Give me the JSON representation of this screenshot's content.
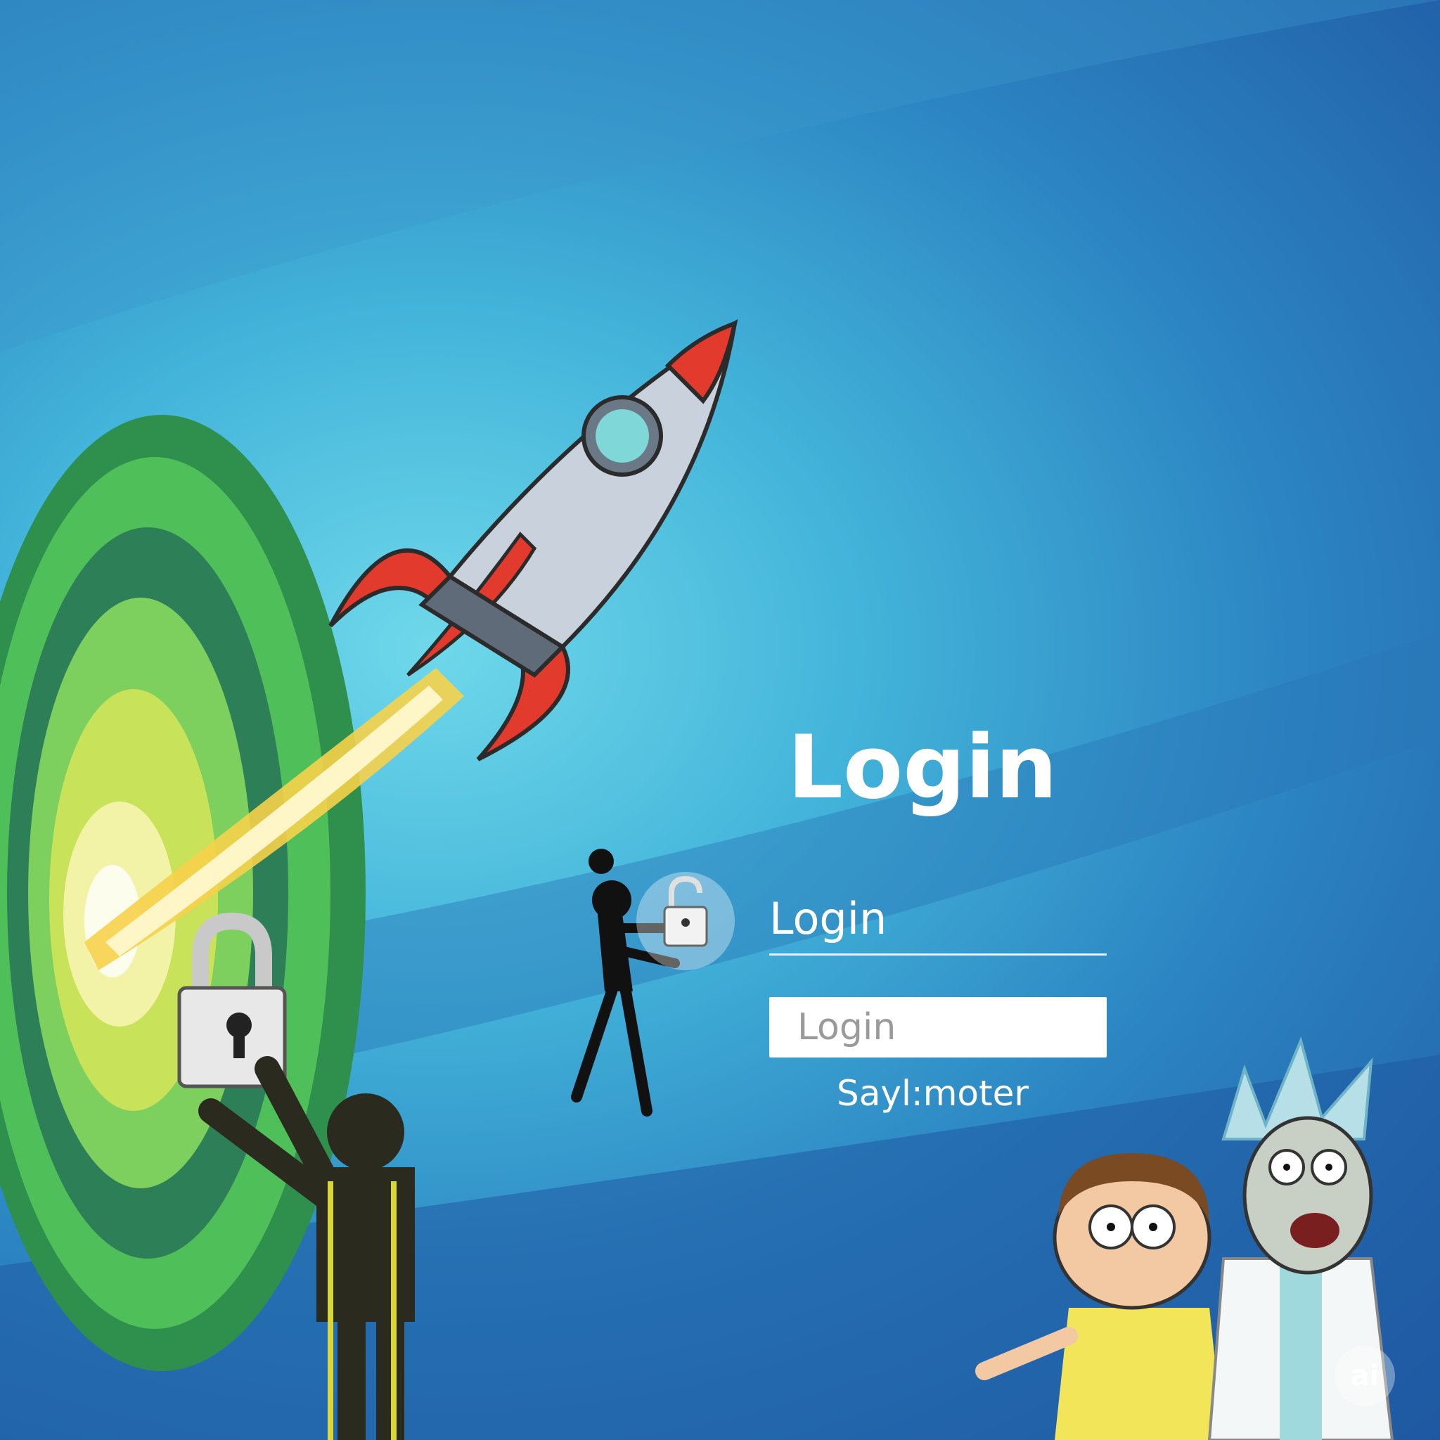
{
  "login_form": {
    "title": "Login",
    "field_label": "Login",
    "input_placeholder": "Login",
    "link_text": "Sayl:moter"
  },
  "badge": {
    "text": "ai"
  },
  "colors": {
    "background_light": "#6fd8ea",
    "background_dark": "#1f58a3",
    "portal_green": "#3cb84a",
    "rocket_red": "#e23b2e",
    "text": "#ffffff"
  },
  "illustration": {
    "elements": [
      "portal",
      "rocket",
      "padlock-icon",
      "unlocked-padlock-icon",
      "silhouette-figure",
      "yellow-suit-figure",
      "cartoon-boy",
      "cartoon-scientist"
    ]
  }
}
